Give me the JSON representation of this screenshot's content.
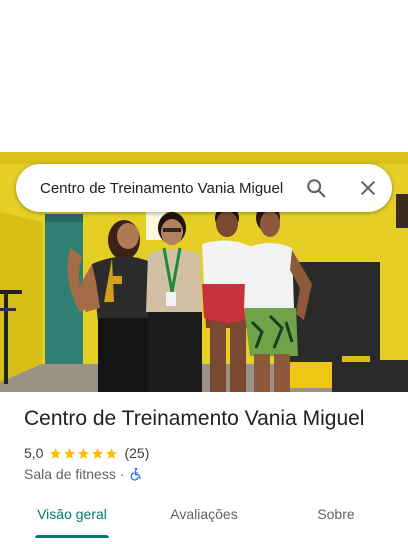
{
  "search": {
    "query": "Centro de Treinamento Vania Miguel"
  },
  "place": {
    "name": "Centro de Treinamento Vania Miguel",
    "rating": "5,0",
    "rating_value": 5.0,
    "review_count": "(25)",
    "category": "Sala de fitness",
    "separator": "·",
    "accessibility_icon": "wheelchair-icon"
  },
  "tabs": [
    {
      "label": "Visão geral",
      "active": true
    },
    {
      "label": "Avaliações",
      "active": false
    },
    {
      "label": "Sobre",
      "active": false
    }
  ],
  "colors": {
    "accent": "#01796f",
    "star": "#fbbc04",
    "accessibility": "#1a73e8",
    "wall": "#e5cf27"
  }
}
